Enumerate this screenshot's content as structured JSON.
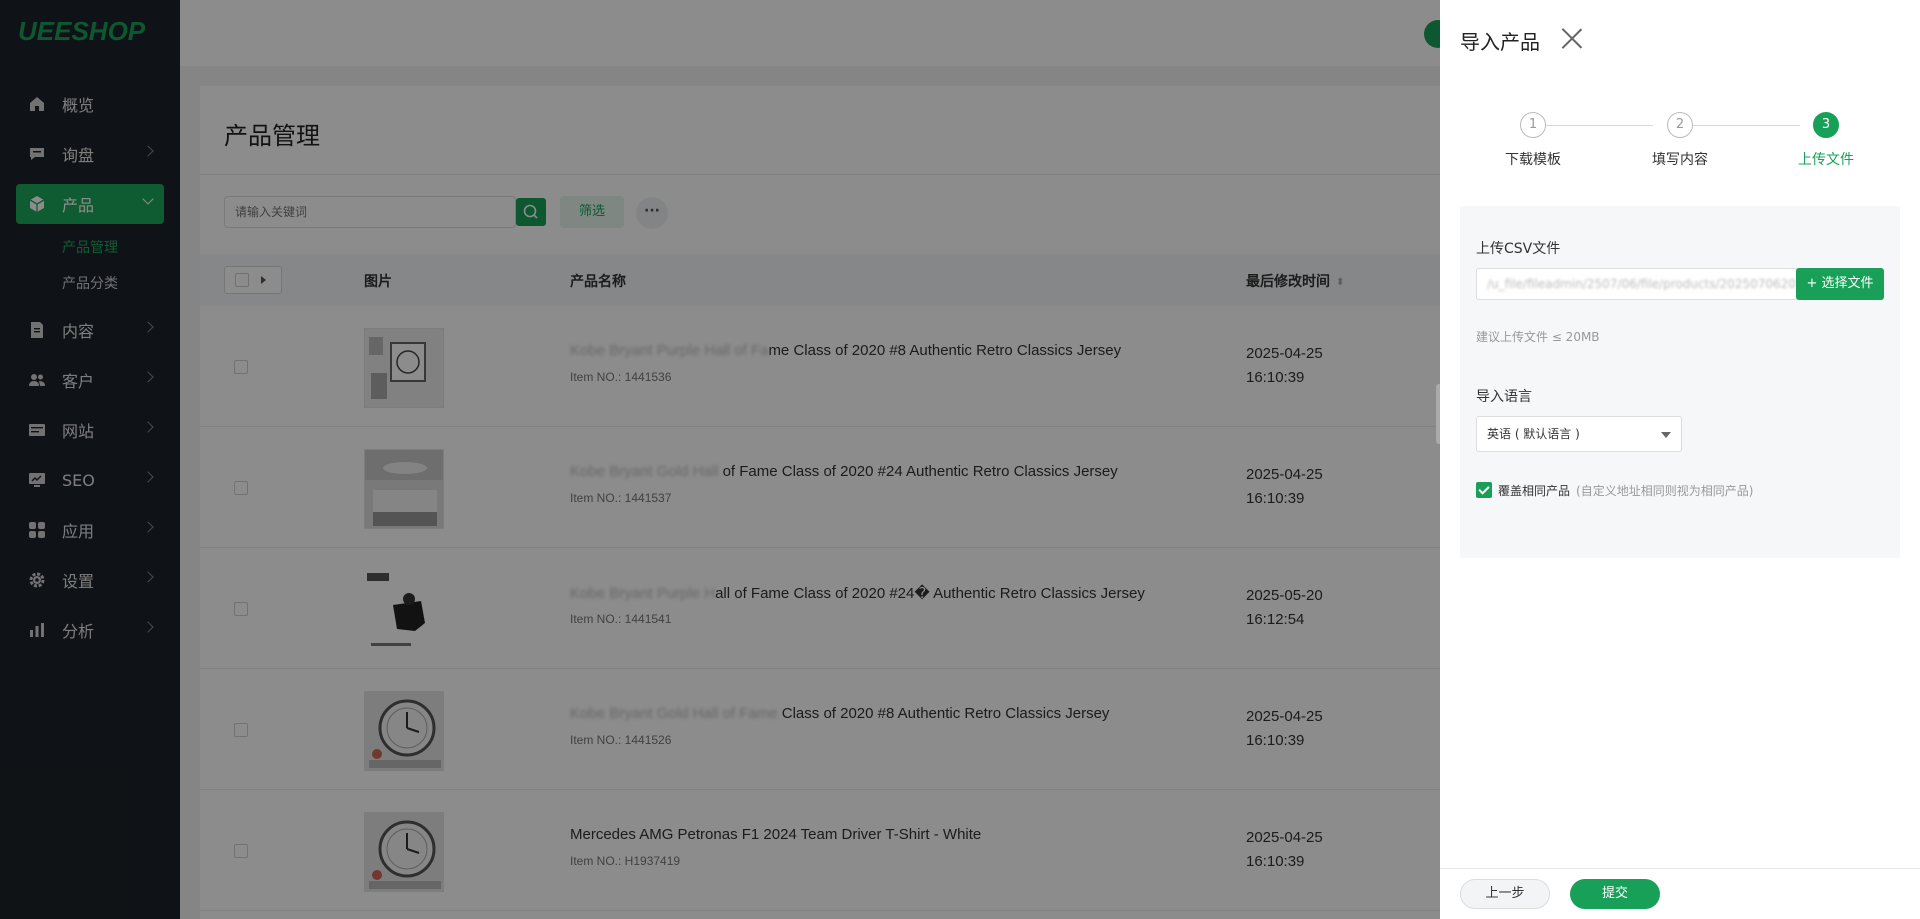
{
  "brand": {
    "logo_text": "UEESHOP",
    "accent_color": "#18a058"
  },
  "sidebar": {
    "items": [
      {
        "label": "概览",
        "icon": "home-icon"
      },
      {
        "label": "询盘",
        "icon": "message-icon"
      },
      {
        "label": "产品",
        "icon": "box-icon",
        "active": true
      },
      {
        "label": "内容",
        "icon": "document-icon"
      },
      {
        "label": "客户",
        "icon": "users-icon"
      },
      {
        "label": "网站",
        "icon": "website-icon"
      },
      {
        "label": "SEO",
        "icon": "seo-icon"
      },
      {
        "label": "应用",
        "icon": "apps-icon"
      },
      {
        "label": "设置",
        "icon": "gear-icon"
      },
      {
        "label": "分析",
        "icon": "chart-icon"
      }
    ],
    "sub_items": [
      {
        "label": "产品管理",
        "active": true
      },
      {
        "label": "产品分类"
      }
    ]
  },
  "page": {
    "title": "产品管理",
    "search_placeholder": "请输入关键词",
    "filter_label": "筛选",
    "more_label": "···"
  },
  "table": {
    "headers": {
      "image": "图片",
      "name": "产品名称",
      "modified": "最后修改时间"
    },
    "rows": [
      {
        "name_faded": "Kobe Bryant Purple Hall of Fa",
        "name": "me Class of 2020 #8 Authentic Retro Classics Jersey",
        "item_no": "Item NO.: 1441536",
        "date": "2025-04-25",
        "time": "16:10:39"
      },
      {
        "name_faded": "Kobe Bryant Gold Hall ",
        "name": "of Fame Class of 2020 #24 Authentic Retro Classics Jersey",
        "item_no": "Item NO.: 1441537",
        "date": "2025-04-25",
        "time": "16:10:39"
      },
      {
        "name_faded": "Kobe Bryant Purple H",
        "name": "all of Fame Class of 2020 #24� Authentic Retro Classics Jersey",
        "item_no": "Item NO.: 1441541",
        "date": "2025-05-20",
        "time": "16:12:54"
      },
      {
        "name_faded": "Kobe Bryant Gold Hall of Fame ",
        "name": "Class of 2020 #8 Authentic Retro Classics Jersey",
        "item_no": "Item NO.: 1441526",
        "date": "2025-04-25",
        "time": "16:10:39"
      },
      {
        "name_faded": "",
        "name": "Mercedes AMG Petronas F1 2024 Team Driver T-Shirt - White",
        "item_no": "Item NO.: H1937419",
        "date": "2025-04-25",
        "time": "16:10:39"
      }
    ]
  },
  "drawer": {
    "title": "导入产品",
    "steps": [
      {
        "num": "1",
        "label": "下载模板"
      },
      {
        "num": "2",
        "label": "填写内容"
      },
      {
        "num": "3",
        "label": "上传文件",
        "active": true
      }
    ],
    "upload_label": "上传CSV文件",
    "file_path": "/u_file/fileadmin/2507/06/file/products/20250706201",
    "choose_file_label": "+ 选择文件",
    "upload_hint": "建议上传文件 ≤ 20MB",
    "language_label": "导入语言",
    "language_value": "英语 ( 默认语言 )",
    "overwrite_label": "覆盖相同产品",
    "overwrite_note": "(自定义地址相同则视为相同产品)",
    "overwrite_checked": true,
    "prev_label": "上一步",
    "submit_label": "提交"
  }
}
